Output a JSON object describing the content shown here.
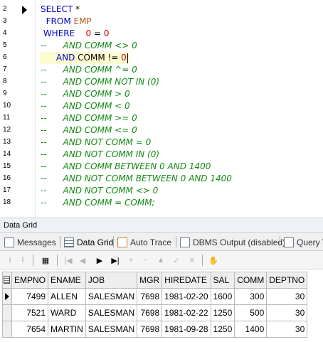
{
  "editor": {
    "lines": [
      {
        "no": "2",
        "parts": [
          [
            "kw",
            "SELECT"
          ],
          [
            "id",
            " *"
          ]
        ],
        "marker": true
      },
      {
        "no": "3",
        "parts": [
          [
            "kw",
            "  FROM"
          ],
          [
            "id",
            " "
          ],
          [
            "tbl",
            "EMP"
          ]
        ]
      },
      {
        "no": "4",
        "parts": [
          [
            "kw",
            " WHERE"
          ],
          [
            "id",
            "    "
          ],
          [
            "num",
            "0"
          ],
          [
            "id",
            " = "
          ],
          [
            "num",
            "0"
          ]
        ]
      },
      {
        "no": "5",
        "parts": [
          [
            "cm-plain",
            "--"
          ],
          [
            "cm",
            "      AND COMM <> 0"
          ]
        ]
      },
      {
        "no": "6",
        "parts": [
          [
            "id",
            "      "
          ],
          [
            "kw",
            "AND"
          ],
          [
            "id",
            " COMM != "
          ],
          [
            "num",
            "0"
          ]
        ],
        "highlight": true,
        "caret": true
      },
      {
        "no": "7",
        "parts": [
          [
            "cm-plain",
            "--"
          ],
          [
            "cm",
            "      AND COMM ^= 0"
          ]
        ]
      },
      {
        "no": "8",
        "parts": [
          [
            "cm-plain",
            "--"
          ],
          [
            "cm",
            "      AND COMM NOT IN (0)"
          ]
        ]
      },
      {
        "no": "9",
        "parts": [
          [
            "cm-plain",
            "--"
          ],
          [
            "cm",
            "      AND COMM > 0"
          ]
        ]
      },
      {
        "no": "10",
        "parts": [
          [
            "cm-plain",
            "--"
          ],
          [
            "cm",
            "      AND COMM < 0"
          ]
        ]
      },
      {
        "no": "11",
        "parts": [
          [
            "cm-plain",
            "--"
          ],
          [
            "cm",
            "      AND COMM >= 0"
          ]
        ]
      },
      {
        "no": "12",
        "parts": [
          [
            "cm-plain",
            "--"
          ],
          [
            "cm",
            "      AND COMM <= 0"
          ]
        ]
      },
      {
        "no": "13",
        "parts": [
          [
            "cm-plain",
            "--"
          ],
          [
            "cm",
            "      AND NOT COMM = 0"
          ]
        ]
      },
      {
        "no": "14",
        "parts": [
          [
            "cm-plain",
            "--"
          ],
          [
            "cm",
            "      AND NOT COMM IN (0)"
          ]
        ]
      },
      {
        "no": "15",
        "parts": [
          [
            "cm-plain",
            "--"
          ],
          [
            "cm",
            "      AND COMM BETWEEN 0 AND 1400"
          ]
        ]
      },
      {
        "no": "16",
        "parts": [
          [
            "cm-plain",
            "--"
          ],
          [
            "cm",
            "      AND NOT COMM BETWEEN 0 AND 1400"
          ]
        ]
      },
      {
        "no": "17",
        "parts": [
          [
            "cm-plain",
            "--"
          ],
          [
            "cm",
            "      AND NOT COMM <> 0"
          ]
        ]
      },
      {
        "no": "18",
        "parts": [
          [
            "cm-plain",
            "--"
          ],
          [
            "cm",
            "      AND COMM = COMM;"
          ]
        ]
      }
    ]
  },
  "panel": {
    "title": "Data Grid",
    "tabs": [
      {
        "label": "Messages",
        "icon": "messages-icon"
      },
      {
        "label": "Data Grid",
        "icon": "data-grid-icon",
        "active": true
      },
      {
        "label": "Auto Trace",
        "icon": "auto-trace-icon"
      },
      {
        "label": "DBMS Output (disabled)",
        "icon": "dbms-output-icon"
      },
      {
        "label": "Query V",
        "icon": "query-viewer-icon"
      }
    ],
    "toolbar": [
      "export-icon",
      "import-icon",
      "grid-options-icon",
      "first-record-icon",
      "prior-icon",
      "next-icon",
      "last-record-icon",
      "insert-icon",
      "delete-icon",
      "edit-icon",
      "post-icon",
      "cancel-icon",
      "refresh-icon"
    ]
  },
  "grid": {
    "columns": [
      "EMPNO",
      "ENAME",
      "JOB",
      "MGR",
      "HIREDATE",
      "SAL",
      "COMM",
      "DEPTNO"
    ],
    "align": [
      "r",
      "l",
      "l",
      "r",
      "r",
      "r",
      "r",
      "r"
    ],
    "rows": [
      [
        "7499",
        "ALLEN",
        "SALESMAN",
        "7698",
        "1981-02-20",
        "1600",
        "300",
        "30"
      ],
      [
        "7521",
        "WARD",
        "SALESMAN",
        "7698",
        "1981-02-22",
        "1250",
        "500",
        "30"
      ],
      [
        "7654",
        "MARTIN",
        "SALESMAN",
        "7698",
        "1981-09-28",
        "1250",
        "1400",
        "30"
      ]
    ],
    "current_row": 0
  }
}
